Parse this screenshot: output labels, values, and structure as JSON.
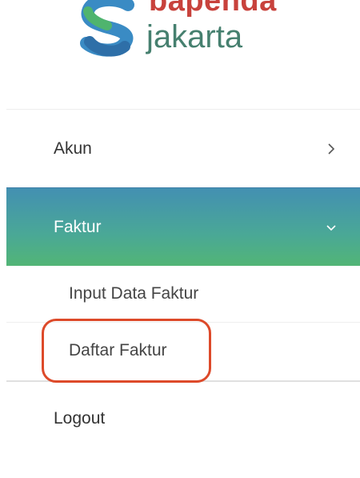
{
  "logo": {
    "name_top": "bapenda",
    "name_bottom": "jakarta"
  },
  "menu": {
    "akun": {
      "label": "Akun",
      "chevron": "chevron-right-icon"
    },
    "faktur": {
      "label": "Faktur",
      "chevron": "chevron-down-icon",
      "active": true,
      "submenu": [
        {
          "label": "Input Data Faktur"
        },
        {
          "label": "Daftar Faktur"
        }
      ]
    },
    "logout": {
      "label": "Logout"
    }
  },
  "colors": {
    "active_gradient_top": "#4390b2",
    "active_gradient_bottom": "#52b576",
    "highlight": "#dd4a2a",
    "logo_red": "#c8423c",
    "logo_green": "#46806f"
  }
}
